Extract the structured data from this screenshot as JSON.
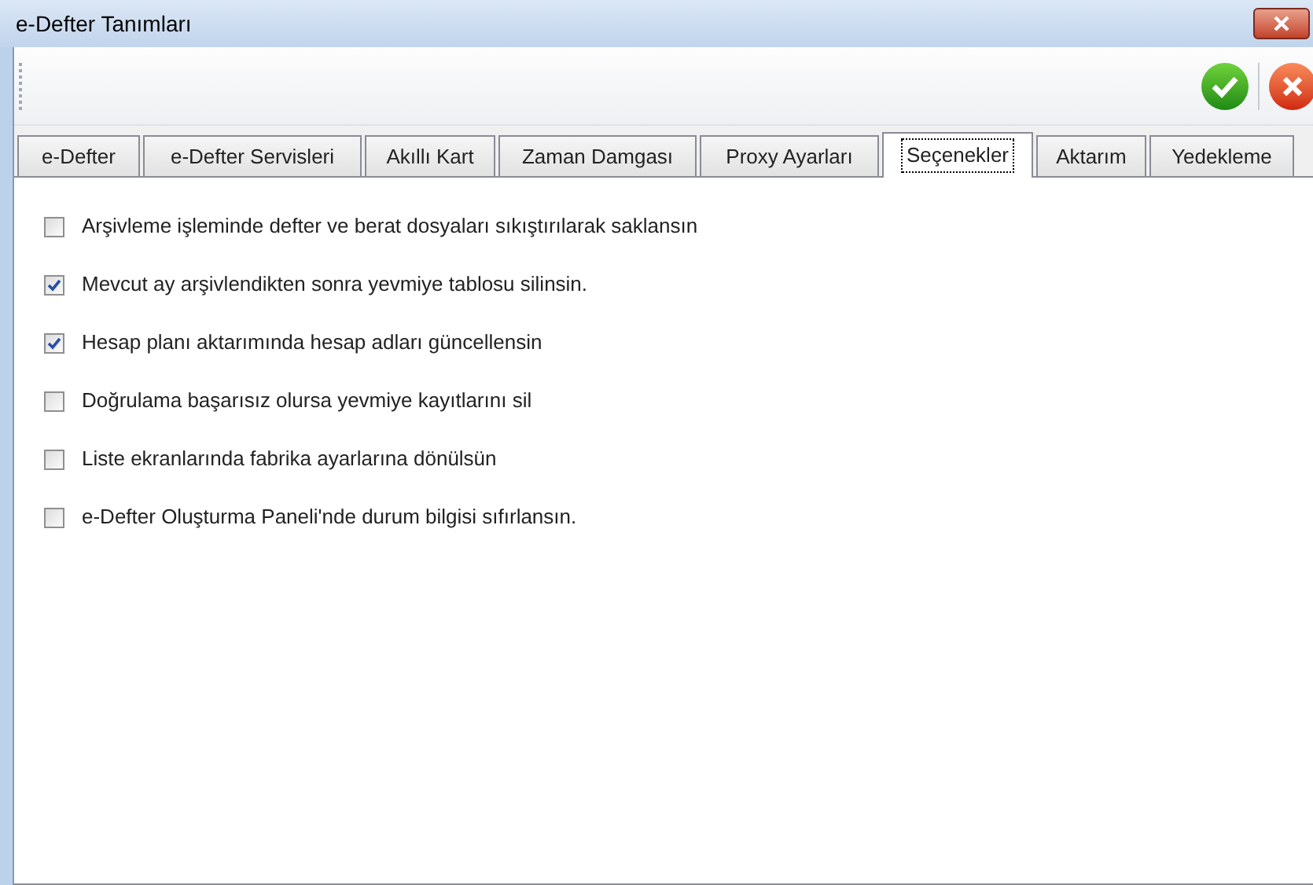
{
  "window": {
    "title": "e-Defter Tanımları"
  },
  "tabs": [
    {
      "label": "e-Defter",
      "selected": false
    },
    {
      "label": "e-Defter Servisleri",
      "selected": false
    },
    {
      "label": "Akıllı Kart",
      "selected": false
    },
    {
      "label": "Zaman Damgası",
      "selected": false
    },
    {
      "label": "Proxy Ayarları",
      "selected": false
    },
    {
      "label": "Seçenekler",
      "selected": true
    },
    {
      "label": "Aktarım",
      "selected": false
    },
    {
      "label": "Yedekleme",
      "selected": false
    }
  ],
  "options": [
    {
      "label": "Arşivleme işleminde defter ve berat dosyaları sıkıştırılarak saklansın",
      "checked": false
    },
    {
      "label": "Mevcut ay arşivlendikten sonra yevmiye tablosu silinsin.",
      "checked": true
    },
    {
      "label": "Hesap planı aktarımında hesap adları güncellensin",
      "checked": true
    },
    {
      "label": "Doğrulama başarısız olursa yevmiye kayıtlarını sil",
      "checked": false
    },
    {
      "label": "Liste ekranlarında fabrika ayarlarına dönülsün",
      "checked": false
    },
    {
      "label": "e-Defter Oluşturma Paneli'nde durum bilgisi sıfırlansın.",
      "checked": false
    }
  ]
}
